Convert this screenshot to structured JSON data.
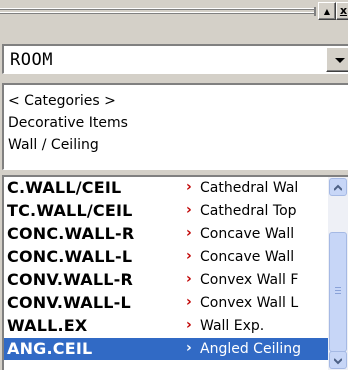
{
  "window": {
    "buttons": {
      "up_label": "▲",
      "close_label": "x"
    }
  },
  "room_combo": {
    "value": "ROOM"
  },
  "categories": [
    {
      "label": "< Categories >"
    },
    {
      "label": "Decorative Items"
    },
    {
      "label": "Wall / Ceiling"
    }
  ],
  "items": [
    {
      "code": "C.WALL/CEIL",
      "marker": "›",
      "desc": "Cathedral Wal"
    },
    {
      "code": "TC.WALL/CEIL",
      "marker": "›",
      "desc": "Cathedral Top"
    },
    {
      "code": "CONC.WALL-R",
      "marker": "›",
      "desc": "Concave Wall"
    },
    {
      "code": "CONC.WALL-L",
      "marker": "›",
      "desc": "Concave Wall"
    },
    {
      "code": "CONV.WALL-R",
      "marker": "›",
      "desc": "Convex Wall F"
    },
    {
      "code": "CONV.WALL-L",
      "marker": "›",
      "desc": "Convex Wall L"
    },
    {
      "code": "WALL.EX",
      "marker": "›",
      "desc": "Wall Exp."
    },
    {
      "code": "ANG.CEIL",
      "marker": "›",
      "desc": "Angled Ceiling"
    }
  ],
  "selected_index": 7,
  "colors": {
    "face": "#d4d0c8",
    "selection": "#316ac5",
    "marker": "#c00000",
    "scrollbar": "#c7d6f7"
  },
  "icons": {
    "scroll_up": "chevron-up-icon",
    "scroll_down": "chevron-down-icon",
    "combo_arrow": "triangle-down-icon"
  }
}
